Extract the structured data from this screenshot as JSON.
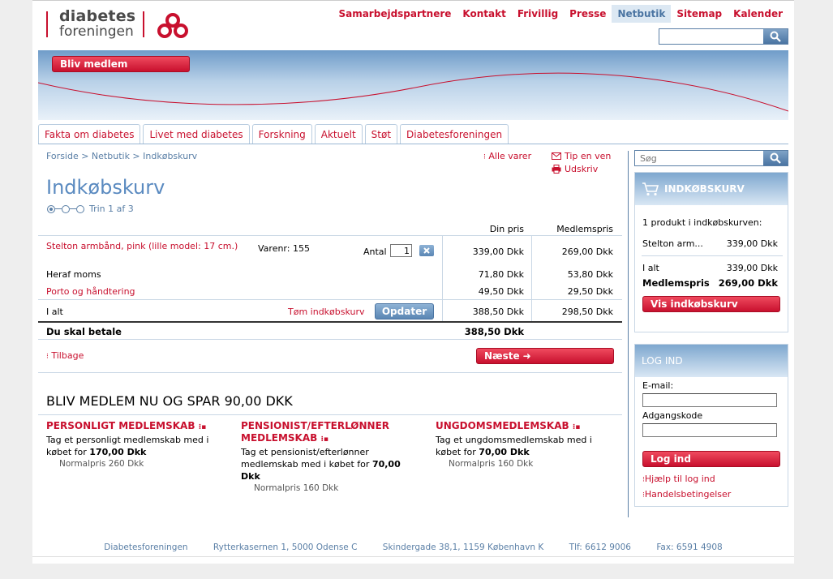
{
  "header": {
    "logo_line1": "diabetes",
    "logo_line2": "foreningen",
    "nav": [
      "Samarbejdspartnere",
      "Kontakt",
      "Frivillig",
      "Presse",
      "Netbutik",
      "Sitemap",
      "Kalender"
    ],
    "search_value": "",
    "join_label": "Bliv medlem"
  },
  "tabs": [
    "Fakta om diabetes",
    "Livet med diabetes",
    "Forskning",
    "Aktuelt",
    "Støt",
    "Diabetesforeningen"
  ],
  "breadcrumb": "Forside > Netbutik > Indkøbskurv",
  "actions": {
    "all_items": "Alle varer",
    "tip": "Tip en ven",
    "print": "Udskriv"
  },
  "cart": {
    "title": "Indkøbskurv",
    "step": "Trin 1 af 3",
    "col_price": "Din pris",
    "col_member": "Medlemspris",
    "item_name": "Stelton armbånd, pink (lille model: 17 cm.)",
    "item_no": "Varenr: 155",
    "qty_label": "Antal",
    "qty": "1",
    "item_price": "339,00 Dkk",
    "item_member": "269,00 Dkk",
    "vat_label": "Heraf moms",
    "vat_price": "71,80 Dkk",
    "vat_member": "53,80 Dkk",
    "shipping_label": "Porto og håndtering",
    "shipping_price": "49,50 Dkk",
    "shipping_member": "29,50 Dkk",
    "total_label": "I alt",
    "empty_label": "Tøm indkøbskurv",
    "update_label": "Opdater",
    "total_price": "388,50 Dkk",
    "total_member": "298,50 Dkk",
    "pay_label": "Du skal betale",
    "pay_amount": "388,50 Dkk",
    "back_label": "Tilbage",
    "next_label": "Næste"
  },
  "membership": {
    "headline": "BLIV MEDLEM NU OG SPAR 90,00 DKK",
    "offers": [
      {
        "title": "PERSONLIGT MEDLEMSKAB",
        "text": "Tag et personligt medlemskab med i købet for",
        "price": "170,00 Dkk",
        "normal": "Normalpris 260 Dkk"
      },
      {
        "title": "PENSIONIST/EFTERLØNNER MEDLEMSKAB",
        "text": "Tag et pensionist/efterlønner medlemskab med i købet for",
        "price": "70,00 Dkk",
        "normal": "Normalpris 160 Dkk"
      },
      {
        "title": "UNGDOMSMEDLEMSKAB",
        "text": "Tag et ungdomsmedlemskab med i købet for",
        "price": "70,00 Dkk",
        "normal": "Normalpris 160 Dkk"
      }
    ]
  },
  "sidebar": {
    "search_placeholder": "Søg",
    "cart_title": "INDKØBSKURV",
    "cart_count": "1 produkt i indkøbskurven:",
    "cart_item": "Stelton arm...",
    "cart_item_price": "339,00 Dkk",
    "cart_total_label": "I alt",
    "cart_total": "339,00 Dkk",
    "cart_member_label": "Medlemspris",
    "cart_member": "269,00 Dkk",
    "show_cart": "Vis indkøbskurv",
    "login_title": "LOG IND",
    "email_label": "E-mail:",
    "password_label": "Adgangskode",
    "login_button": "Log ind",
    "help_link": "Hjælp til log ind",
    "terms_link": "Handelsbetingelser"
  },
  "footer": [
    "Diabetesforeningen",
    "Rytterkasernen 1, 5000 Odense C",
    "Skindergade 38,1, 1159 København K",
    "Tlf: 6612 9006",
    "Fax: 6591 4908"
  ]
}
